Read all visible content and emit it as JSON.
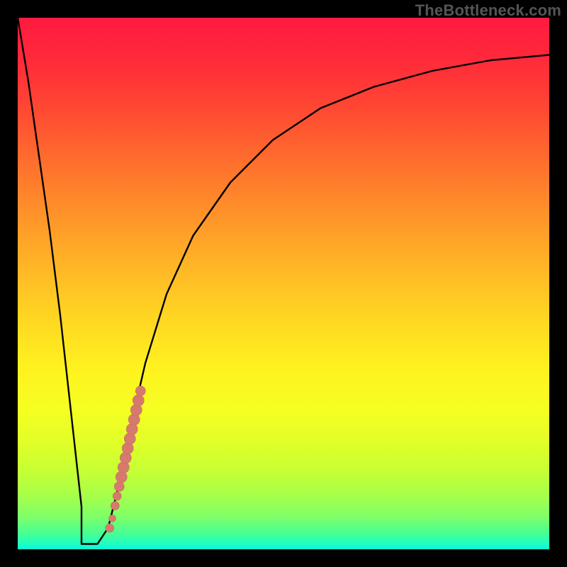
{
  "watermark": "TheBottleneck.com",
  "colors": {
    "curve_stroke": "#000000",
    "dot_fill": "#d77a6e",
    "dot_stroke": "#c46a5f",
    "frame_bg": "#000000"
  },
  "chart_data": {
    "type": "line",
    "title": "",
    "xlabel": "",
    "ylabel": "",
    "xlim": [
      0,
      100
    ],
    "ylim": [
      0,
      100
    ],
    "grid": false,
    "legend": false,
    "series": [
      {
        "name": "bottleneck-curve",
        "x": [
          0,
          2,
          4,
          6,
          8,
          10,
          11,
          12,
          13,
          14,
          15,
          17,
          19,
          21,
          24,
          28,
          33,
          40,
          48,
          57,
          67,
          78,
          89,
          100
        ],
        "values": [
          100,
          88,
          74,
          60,
          44,
          26,
          17,
          8,
          3,
          1,
          1,
          4,
          12,
          22,
          35,
          48,
          59,
          69,
          77,
          83,
          87,
          90,
          92,
          93
        ]
      }
    ],
    "flat_bottom": {
      "x_start": 12,
      "x_end": 15,
      "value": 1
    },
    "dots": {
      "name": "highlight-dots",
      "points": [
        {
          "x": 17.3,
          "y": 4.0,
          "r": 6
        },
        {
          "x": 17.8,
          "y": 5.8,
          "r": 5
        },
        {
          "x": 18.3,
          "y": 8.2,
          "r": 6
        },
        {
          "x": 18.7,
          "y": 10.0,
          "r": 6
        },
        {
          "x": 19.1,
          "y": 11.8,
          "r": 7
        },
        {
          "x": 19.5,
          "y": 13.6,
          "r": 8
        },
        {
          "x": 19.9,
          "y": 15.4,
          "r": 8
        },
        {
          "x": 20.3,
          "y": 17.2,
          "r": 8
        },
        {
          "x": 20.7,
          "y": 19.0,
          "r": 8
        },
        {
          "x": 21.1,
          "y": 20.8,
          "r": 8
        },
        {
          "x": 21.5,
          "y": 22.6,
          "r": 8
        },
        {
          "x": 21.9,
          "y": 24.4,
          "r": 8
        },
        {
          "x": 22.3,
          "y": 26.2,
          "r": 8
        },
        {
          "x": 22.7,
          "y": 28.0,
          "r": 8
        },
        {
          "x": 23.1,
          "y": 29.8,
          "r": 7
        }
      ]
    }
  }
}
